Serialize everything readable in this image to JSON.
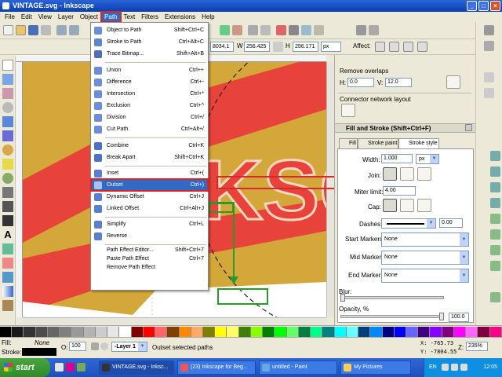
{
  "window": {
    "title": "VINTAGE.svg - Inkscape"
  },
  "menubar": [
    "File",
    "Edit",
    "View",
    "Layer",
    "Object",
    "Path",
    "Text",
    "Filters",
    "Extensions",
    "Help"
  ],
  "toolbar2": {
    "x_label": "X",
    "x_value": "8034.1",
    "w_label": "W",
    "w_value": "256.425",
    "h_label": "H",
    "h_value": "256.171",
    "unit": "px",
    "affect_label": "Affect:"
  },
  "path_menu": {
    "items": [
      {
        "label": "Object to Path",
        "shortcut": "Shift+Ctrl+C"
      },
      {
        "label": "Stroke to Path",
        "shortcut": "Ctrl+Alt+C"
      },
      {
        "label": "Trace Bitmap...",
        "shortcut": "Shift+Alt+B"
      },
      {
        "label": "Union",
        "shortcut": "Ctrl++"
      },
      {
        "label": "Difference",
        "shortcut": "Ctrl+-"
      },
      {
        "label": "Intersection",
        "shortcut": "Ctrl+*"
      },
      {
        "label": "Exclusion",
        "shortcut": "Ctrl+^"
      },
      {
        "label": "Division",
        "shortcut": "Ctrl+/"
      },
      {
        "label": "Cut Path",
        "shortcut": "Ctrl+Alt+/"
      },
      {
        "label": "Combine",
        "shortcut": "Ctrl+K"
      },
      {
        "label": "Break Apart",
        "shortcut": "Shift+Ctrl+K"
      },
      {
        "label": "Inset",
        "shortcut": "Ctrl+("
      },
      {
        "label": "Outset",
        "shortcut": "Ctrl+)"
      },
      {
        "label": "Dynamic Offset",
        "shortcut": "Ctrl+J"
      },
      {
        "label": "Linked Offset",
        "shortcut": "Ctrl+Alt+J"
      },
      {
        "label": "Simplify",
        "shortcut": "Ctrl+L"
      },
      {
        "label": "Reverse",
        "shortcut": ""
      },
      {
        "label": "Path Effect Editor...",
        "shortcut": "Shift+Ctrl+7"
      },
      {
        "label": "Paste Path Effect",
        "shortcut": "Ctrl+7"
      },
      {
        "label": "Remove Path Effect",
        "shortcut": ""
      }
    ]
  },
  "dock": {
    "remove_overlaps": "Remove overlaps",
    "h_label": "H:",
    "h_value": "0.0",
    "v_label": "V:",
    "v_value": "12.0",
    "connector_layout": "Connector network layout",
    "fill_stroke_title": "Fill and Stroke (Shift+Ctrl+F)",
    "tabs": [
      "Fill",
      "Stroke paint",
      "Stroke style"
    ],
    "width_label": "Width:",
    "width_value": "1.000",
    "width_unit": "px",
    "join_label": "Join:",
    "miter_label": "Miter limit:",
    "miter_value": "4.00",
    "cap_label": "Cap:",
    "dashes_label": "Dashes:",
    "dashes_value": "0.00",
    "start_markers_label": "Start Markers:",
    "start_markers_value": "None",
    "mid_markers_label": "Mid Markers:",
    "mid_markers_value": "None",
    "end_markers_label": "End Markers:",
    "end_markers_value": "None",
    "blur_label": "Blur:",
    "opacity_label": "Opacity, %",
    "opacity_value": "100.0",
    "blur_fraction": 0.0,
    "opacity_fraction": 1.0
  },
  "canvas": {
    "big_text": "KSC"
  },
  "statusbar": {
    "fill_label": "Fill:",
    "fill_value": "None",
    "stroke_label": "Stroke:",
    "opacity_label": "O:",
    "opacity_value": "100",
    "layer": "-Layer 1",
    "message": "Outset selected paths",
    "x_coord": "X: -765.73",
    "y_coord": "Y: -7804.55",
    "z_label": "Z:",
    "zoom": "235%"
  },
  "taskbar": {
    "start": "start",
    "tasks": [
      "VINTAGE.svg - Inksc...",
      "(23) Inkscape for Beg...",
      "untitled - Paint",
      "My Pictures"
    ],
    "lang": "EN",
    "clock": "12:05"
  },
  "colors": {
    "accent": "#316ac5",
    "canvas_gold": "#d4a73a",
    "canvas_red": "#e8433a",
    "annot_red": "#d42a2a",
    "annot_green": "#2a9a2a"
  }
}
